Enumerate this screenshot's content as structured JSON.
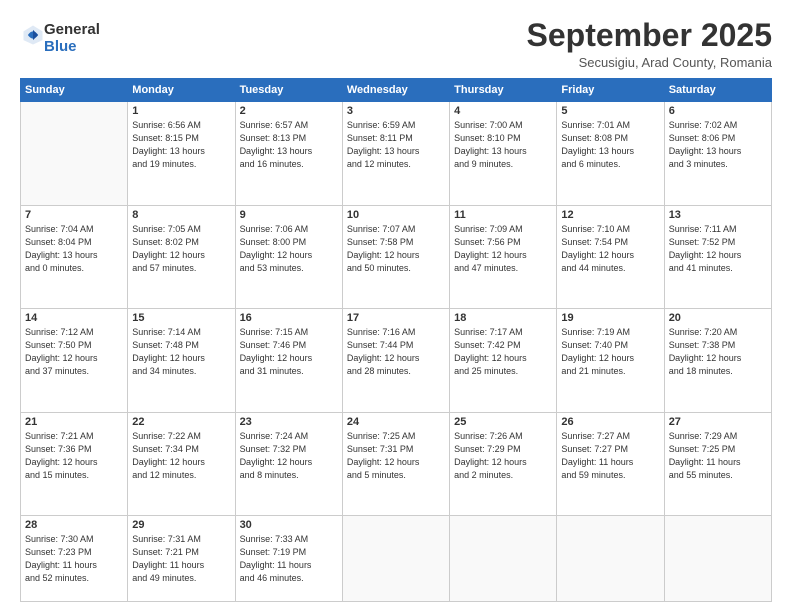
{
  "logo": {
    "general": "General",
    "blue": "Blue"
  },
  "header": {
    "title": "September 2025",
    "subtitle": "Secusigiu, Arad County, Romania"
  },
  "weekdays": [
    "Sunday",
    "Monday",
    "Tuesday",
    "Wednesday",
    "Thursday",
    "Friday",
    "Saturday"
  ],
  "weeks": [
    [
      {
        "day": "",
        "info": ""
      },
      {
        "day": "1",
        "info": "Sunrise: 6:56 AM\nSunset: 8:15 PM\nDaylight: 13 hours\nand 19 minutes."
      },
      {
        "day": "2",
        "info": "Sunrise: 6:57 AM\nSunset: 8:13 PM\nDaylight: 13 hours\nand 16 minutes."
      },
      {
        "day": "3",
        "info": "Sunrise: 6:59 AM\nSunset: 8:11 PM\nDaylight: 13 hours\nand 12 minutes."
      },
      {
        "day": "4",
        "info": "Sunrise: 7:00 AM\nSunset: 8:10 PM\nDaylight: 13 hours\nand 9 minutes."
      },
      {
        "day": "5",
        "info": "Sunrise: 7:01 AM\nSunset: 8:08 PM\nDaylight: 13 hours\nand 6 minutes."
      },
      {
        "day": "6",
        "info": "Sunrise: 7:02 AM\nSunset: 8:06 PM\nDaylight: 13 hours\nand 3 minutes."
      }
    ],
    [
      {
        "day": "7",
        "info": "Sunrise: 7:04 AM\nSunset: 8:04 PM\nDaylight: 13 hours\nand 0 minutes."
      },
      {
        "day": "8",
        "info": "Sunrise: 7:05 AM\nSunset: 8:02 PM\nDaylight: 12 hours\nand 57 minutes."
      },
      {
        "day": "9",
        "info": "Sunrise: 7:06 AM\nSunset: 8:00 PM\nDaylight: 12 hours\nand 53 minutes."
      },
      {
        "day": "10",
        "info": "Sunrise: 7:07 AM\nSunset: 7:58 PM\nDaylight: 12 hours\nand 50 minutes."
      },
      {
        "day": "11",
        "info": "Sunrise: 7:09 AM\nSunset: 7:56 PM\nDaylight: 12 hours\nand 47 minutes."
      },
      {
        "day": "12",
        "info": "Sunrise: 7:10 AM\nSunset: 7:54 PM\nDaylight: 12 hours\nand 44 minutes."
      },
      {
        "day": "13",
        "info": "Sunrise: 7:11 AM\nSunset: 7:52 PM\nDaylight: 12 hours\nand 41 minutes."
      }
    ],
    [
      {
        "day": "14",
        "info": "Sunrise: 7:12 AM\nSunset: 7:50 PM\nDaylight: 12 hours\nand 37 minutes."
      },
      {
        "day": "15",
        "info": "Sunrise: 7:14 AM\nSunset: 7:48 PM\nDaylight: 12 hours\nand 34 minutes."
      },
      {
        "day": "16",
        "info": "Sunrise: 7:15 AM\nSunset: 7:46 PM\nDaylight: 12 hours\nand 31 minutes."
      },
      {
        "day": "17",
        "info": "Sunrise: 7:16 AM\nSunset: 7:44 PM\nDaylight: 12 hours\nand 28 minutes."
      },
      {
        "day": "18",
        "info": "Sunrise: 7:17 AM\nSunset: 7:42 PM\nDaylight: 12 hours\nand 25 minutes."
      },
      {
        "day": "19",
        "info": "Sunrise: 7:19 AM\nSunset: 7:40 PM\nDaylight: 12 hours\nand 21 minutes."
      },
      {
        "day": "20",
        "info": "Sunrise: 7:20 AM\nSunset: 7:38 PM\nDaylight: 12 hours\nand 18 minutes."
      }
    ],
    [
      {
        "day": "21",
        "info": "Sunrise: 7:21 AM\nSunset: 7:36 PM\nDaylight: 12 hours\nand 15 minutes."
      },
      {
        "day": "22",
        "info": "Sunrise: 7:22 AM\nSunset: 7:34 PM\nDaylight: 12 hours\nand 12 minutes."
      },
      {
        "day": "23",
        "info": "Sunrise: 7:24 AM\nSunset: 7:32 PM\nDaylight: 12 hours\nand 8 minutes."
      },
      {
        "day": "24",
        "info": "Sunrise: 7:25 AM\nSunset: 7:31 PM\nDaylight: 12 hours\nand 5 minutes."
      },
      {
        "day": "25",
        "info": "Sunrise: 7:26 AM\nSunset: 7:29 PM\nDaylight: 12 hours\nand 2 minutes."
      },
      {
        "day": "26",
        "info": "Sunrise: 7:27 AM\nSunset: 7:27 PM\nDaylight: 11 hours\nand 59 minutes."
      },
      {
        "day": "27",
        "info": "Sunrise: 7:29 AM\nSunset: 7:25 PM\nDaylight: 11 hours\nand 55 minutes."
      }
    ],
    [
      {
        "day": "28",
        "info": "Sunrise: 7:30 AM\nSunset: 7:23 PM\nDaylight: 11 hours\nand 52 minutes."
      },
      {
        "day": "29",
        "info": "Sunrise: 7:31 AM\nSunset: 7:21 PM\nDaylight: 11 hours\nand 49 minutes."
      },
      {
        "day": "30",
        "info": "Sunrise: 7:33 AM\nSunset: 7:19 PM\nDaylight: 11 hours\nand 46 minutes."
      },
      {
        "day": "",
        "info": ""
      },
      {
        "day": "",
        "info": ""
      },
      {
        "day": "",
        "info": ""
      },
      {
        "day": "",
        "info": ""
      }
    ]
  ]
}
